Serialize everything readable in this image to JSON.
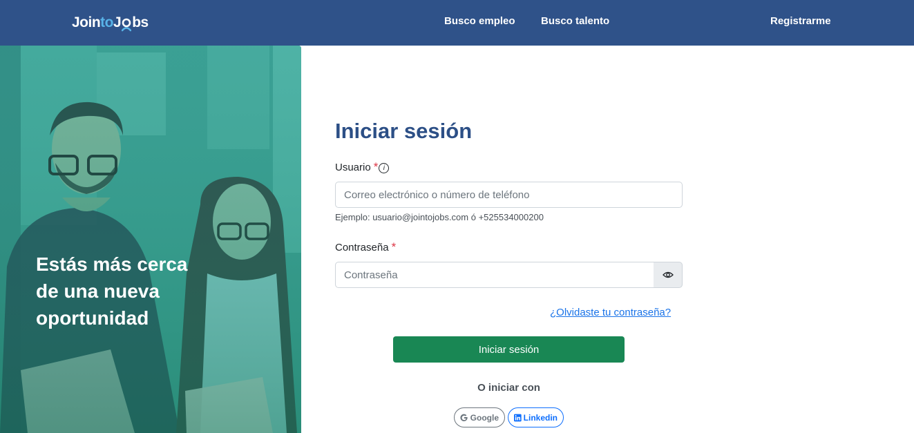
{
  "navbar": {
    "logo": {
      "part1": "Join",
      "part2": "to",
      "part3": "J",
      "part4": "bs"
    },
    "links": {
      "busco_empleo": "Busco empleo",
      "busco_talento": "Busco talento",
      "registrarme": "Registrarme"
    }
  },
  "hero": {
    "line1": "Estás más cerca",
    "line2": "de una nueva",
    "line3": "oportunidad"
  },
  "login": {
    "title": "Iniciar sesión",
    "usuario_label": "Usuario",
    "required_mark": "*",
    "info_glyph": "i",
    "usuario_placeholder": "Correo electrónico o número de teléfono",
    "usuario_value": "",
    "usuario_hint": "Ejemplo: usuario@jointojobs.com ó +525534000200",
    "password_label": "Contraseña",
    "password_placeholder": "Contraseña",
    "password_value": "",
    "forgot_link": "¿Olvidaste tu contraseña?",
    "submit_label": "Iniciar sesión",
    "or_text": "O iniciar con",
    "google_label": "Google",
    "linkedin_label": "Linkedin"
  },
  "icons": {
    "eye": "eye-icon",
    "info": "info-icon",
    "google": "google-icon",
    "linkedin": "linkedin-icon"
  },
  "colors": {
    "navbar": "#2f5289",
    "title": "#2c4f86",
    "primary_button": "#198754",
    "link": "#1a73e8",
    "required": "#dc3545",
    "hero_overlay": "#3fa595"
  }
}
